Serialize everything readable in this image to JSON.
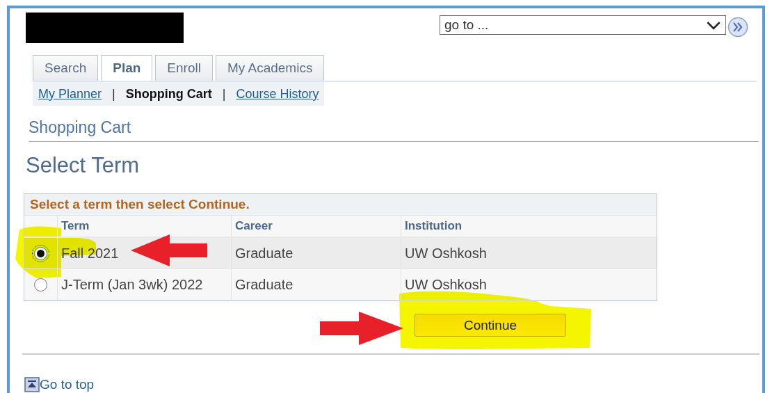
{
  "goto_select": {
    "value": "go to ..."
  },
  "tabs": [
    {
      "label": "Search",
      "selected": false
    },
    {
      "label": "Plan",
      "selected": true
    },
    {
      "label": "Enroll",
      "selected": false
    },
    {
      "label": "My Academics",
      "selected": false
    }
  ],
  "subnav": [
    {
      "kind": "link",
      "label": "My Planner",
      "selected": false
    },
    {
      "kind": "separator",
      "label": "|"
    },
    {
      "kind": "link",
      "label": "Shopping Cart",
      "selected": true
    },
    {
      "kind": "separator",
      "label": "|"
    },
    {
      "kind": "link",
      "label": "Course History",
      "selected": false
    }
  ],
  "page_title": "Shopping Cart",
  "section_title": "Select Term",
  "table": {
    "caption": "Select a term then select Continue.",
    "columns": [
      "Term",
      "Career",
      "Institution"
    ],
    "rows": [
      {
        "selected": true,
        "cells": [
          "Fall 2021",
          "Graduate",
          "UW Oshkosh"
        ]
      },
      {
        "selected": false,
        "cells": [
          "J-Term (Jan 3wk) 2022",
          "Graduate",
          "UW Oshkosh"
        ]
      }
    ]
  },
  "continue_button": "Continue",
  "go_to_top": "Go to top"
}
